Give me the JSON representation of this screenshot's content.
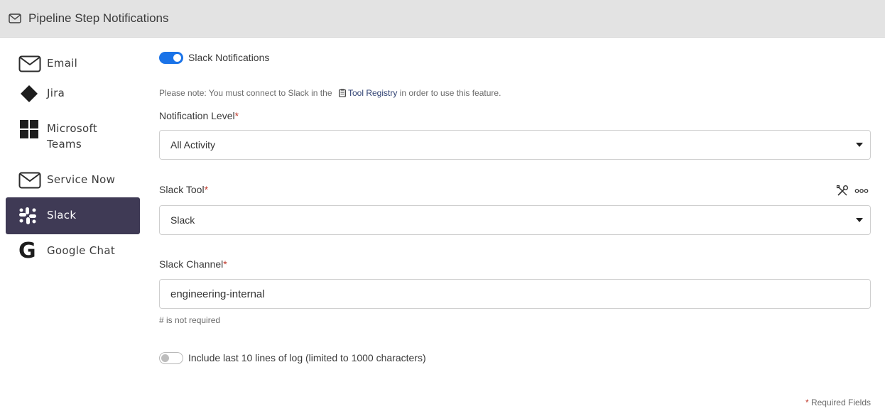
{
  "header": {
    "title": "Pipeline Step Notifications",
    "icon": "envelope-icon"
  },
  "sidebar": {
    "items": [
      {
        "label": "Email",
        "icon": "envelope-icon"
      },
      {
        "label": "Jira",
        "icon": "jira-icon"
      },
      {
        "label": "Microsoft Teams",
        "icon": "windows-icon"
      },
      {
        "label": "Service Now",
        "icon": "envelope-icon"
      },
      {
        "label": "Slack",
        "icon": "slack-icon",
        "active": true
      },
      {
        "label": "Google Chat",
        "icon": "google-icon"
      }
    ]
  },
  "form": {
    "toggle_label": "Slack Notifications",
    "toggle_on": true,
    "note_prefix": "Please note: You must connect to Slack in the",
    "note_link": "Tool Registry",
    "note_suffix": "in order to use this feature.",
    "level_label": "Notification Level",
    "level_value": "All Activity",
    "tool_label": "Slack Tool",
    "tool_value": "Slack",
    "channel_label": "Slack Channel",
    "channel_value": "engineering-internal",
    "channel_hint": "# is not required",
    "log_label": "Include last 10 lines of log (limited to 1000 characters)",
    "log_on": false,
    "required_star": "*",
    "required_note": "* Required Fields"
  },
  "colors": {
    "active_bg": "#3f3a55",
    "toggle_on": "#1a73e8",
    "required": "#c0392b"
  }
}
